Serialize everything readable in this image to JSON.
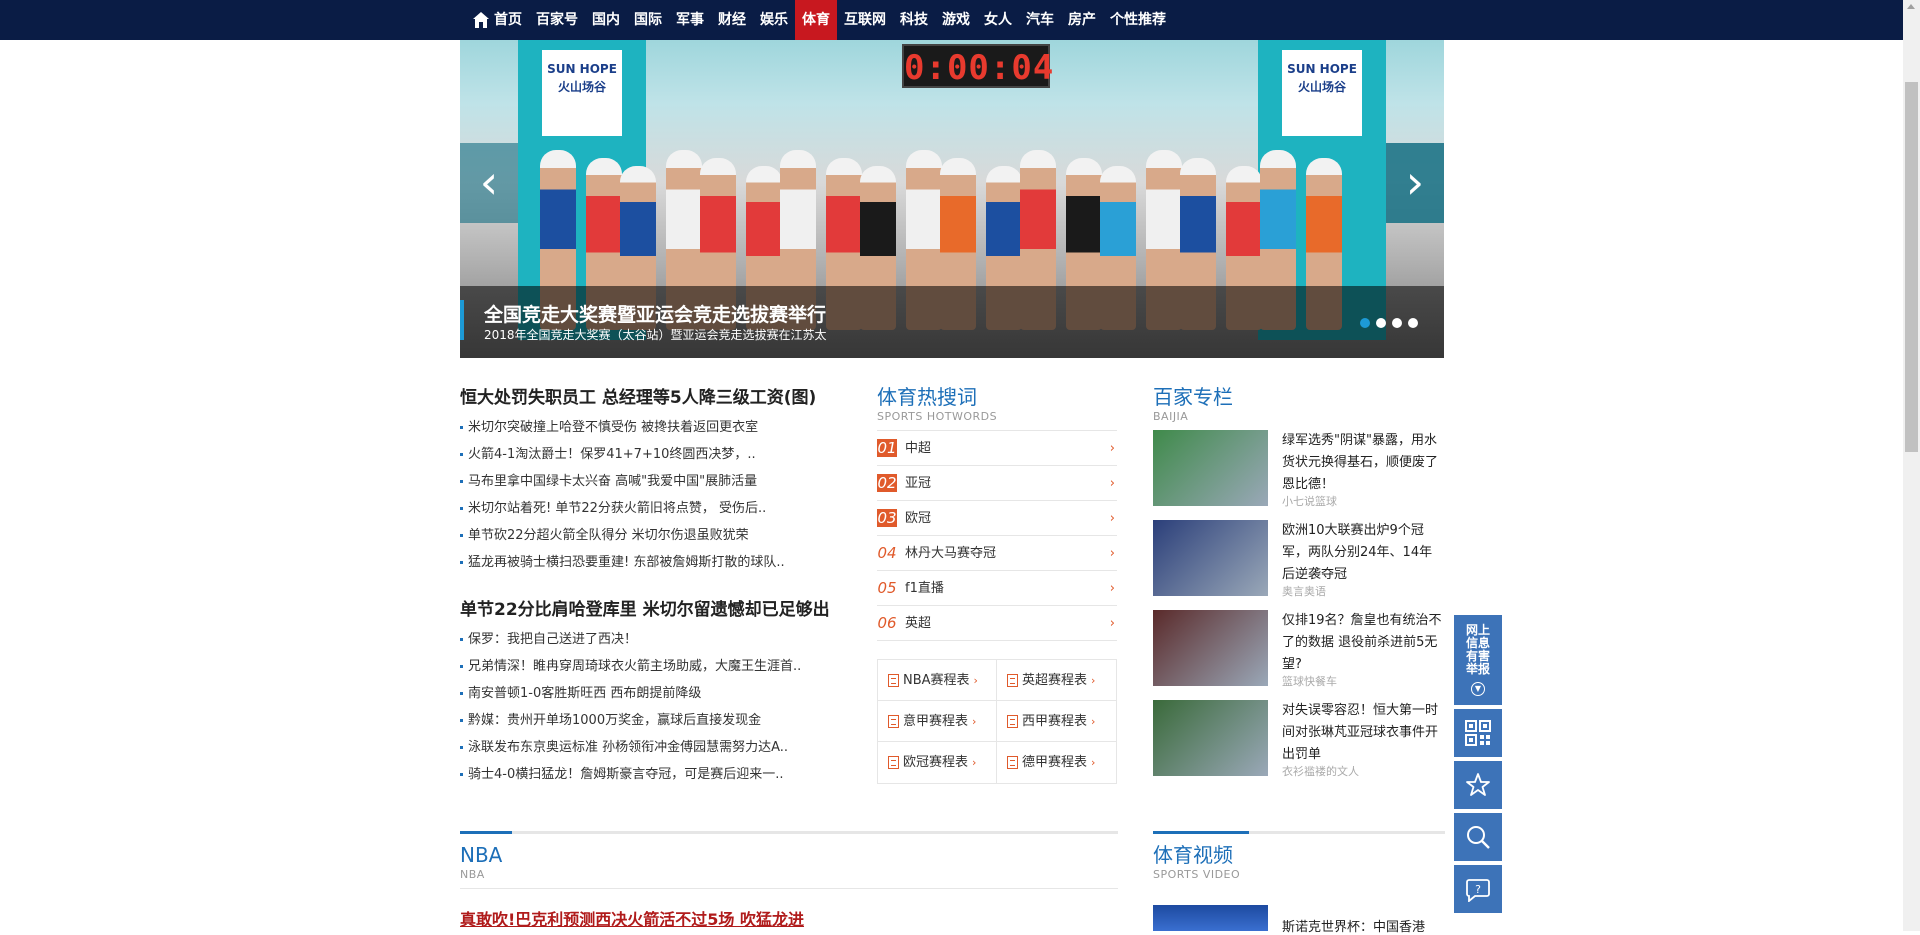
{
  "nav": {
    "items": [
      {
        "label": "首页",
        "active": false
      },
      {
        "label": "百家号",
        "active": false
      },
      {
        "label": "国内",
        "active": false
      },
      {
        "label": "国际",
        "active": false
      },
      {
        "label": "军事",
        "active": false
      },
      {
        "label": "财经",
        "active": false
      },
      {
        "label": "娱乐",
        "active": false
      },
      {
        "label": "体育",
        "active": true
      },
      {
        "label": "互联网",
        "active": false
      },
      {
        "label": "科技",
        "active": false
      },
      {
        "label": "游戏",
        "active": false
      },
      {
        "label": "女人",
        "active": false
      },
      {
        "label": "汽车",
        "active": false
      },
      {
        "label": "房产",
        "active": false
      },
      {
        "label": "个性推荐",
        "active": false
      }
    ]
  },
  "slider": {
    "clock": "0:00:04",
    "brand_line1": "SUN HOPE",
    "brand_line2": "火山场谷",
    "caption_title": "全国竞走大奖赛暨亚运会竞走选拔赛举行",
    "caption_sub": "2018年全国竞走大奖赛（太谷站）暨亚运会竞走选拔赛在江苏太",
    "prev": "‹",
    "next": "›",
    "dots": [
      true,
      false,
      false,
      false
    ]
  },
  "news": {
    "headline1": "恒大处罚失职员工 总经理等5人降三级工资(图)",
    "list1": [
      "米切尔突破撞上哈登不慎受伤 被搀扶着返回更衣室",
      "火箭4-1淘汰爵士！保罗41+7+10终圆西决梦，..",
      "马布里拿中国绿卡太兴奋 高喊\"我爱中国\"展肺活量",
      "米切尔站着死! 单节22分获火箭旧将点赞， 受伤后..",
      "单节砍22分超火箭全队得分 米切尔伤退虽败犹荣",
      "猛龙再被骑士横扫恐要重建! 东部被詹姆斯打散的球队.."
    ],
    "headline2": "单节22分比肩哈登库里 米切尔留遗憾却已足够出",
    "list2": [
      "保罗：我把自己送进了西决！",
      "兄弟情深！睢冉穿周琦球衣火箭主场助威，大魔王生涯首..",
      "南安普顿1-0客胜斯旺西 西布朗提前降级",
      "黔媒：贵州开单场1000万奖金，赢球后直接发现金",
      "泳联发布东京奥运标准 孙杨领衔冲金傅园慧需努力达A..",
      "骑士4-0横扫猛龙！詹姆斯豪言夺冠，可是赛后迎来一.."
    ]
  },
  "hot": {
    "title": "体育热搜词",
    "subtitle": "SPORTS HOTWORDS",
    "items": [
      {
        "rank": "01",
        "label": "中超",
        "top": true
      },
      {
        "rank": "02",
        "label": "亚冠",
        "top": true
      },
      {
        "rank": "03",
        "label": "欧冠",
        "top": true
      },
      {
        "rank": "04",
        "label": "林丹大马赛夺冠",
        "top": false
      },
      {
        "rank": "05",
        "label": "f1直播",
        "top": false
      },
      {
        "rank": "06",
        "label": "英超",
        "top": false
      }
    ],
    "chevron": "›",
    "schedules": [
      "NBA赛程表",
      "英超赛程表",
      "意甲赛程表",
      "西甲赛程表",
      "欧冠赛程表",
      "德甲赛程表"
    ]
  },
  "baijia": {
    "title": "百家专栏",
    "subtitle": "BAIJIA",
    "items": [
      {
        "title": "绿军选秀\"阴谋\"暴露，用水货状元换得基石，顺便废了恩比德！",
        "source": "小七说篮球",
        "color": "#3f8a4a"
      },
      {
        "title": "欧洲10大联赛出炉9个冠军，两队分别24年、14年后逆袭夺冠",
        "source": "奥言奥语",
        "color": "#2b3f7a"
      },
      {
        "title": "仅排19名？詹皇也有统治不了的数据 退役前杀进前5无望?",
        "source": "篮球快餐车",
        "color": "#5a2a2a"
      },
      {
        "title": "对失误零容忍！恒大第一时间对张琳芃亚冠球衣事件开出罚单",
        "source": "衣衫褴褛的文人",
        "color": "#3a6a3a"
      }
    ]
  },
  "nba": {
    "title": "NBA",
    "subtitle": "NBA",
    "headline": "真敢吹!巴克利预测西决火箭活不过5场 吹猛龙进"
  },
  "video": {
    "title": "体育视频",
    "subtitle": "SPORTS VIDEO",
    "item_title": "斯诺克世界杯：中国香港"
  },
  "floatbar": {
    "report": "网上信息有害举报",
    "report_arrow": "▼"
  }
}
